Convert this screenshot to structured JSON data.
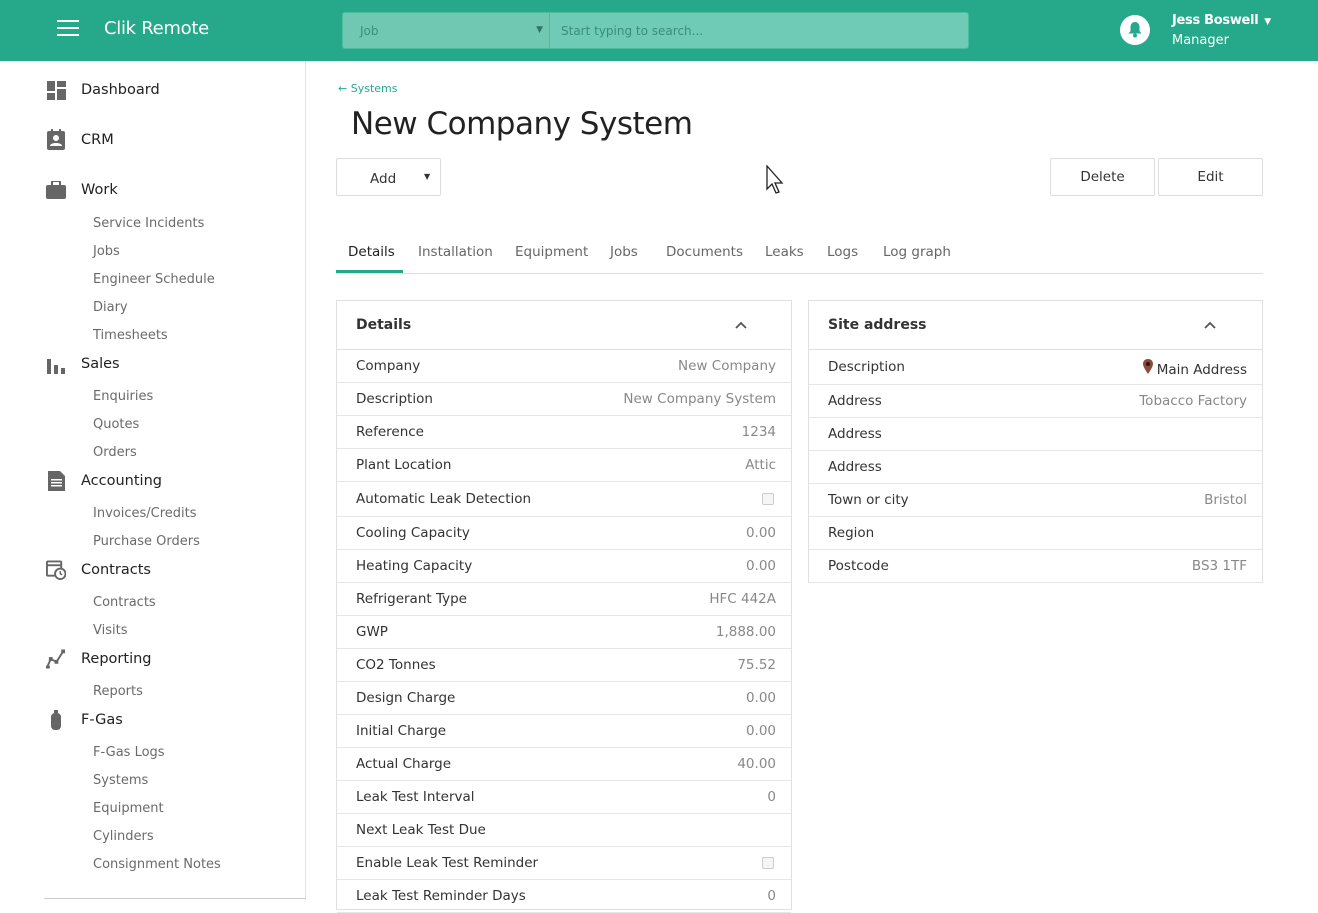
{
  "app": {
    "name": "Clik Remote"
  },
  "search": {
    "category": "Job",
    "placeholder": "Start typing to search..."
  },
  "user": {
    "name": "Jess Boswell",
    "role": "Manager"
  },
  "sidebar": {
    "sections": [
      {
        "label": "Dashboard",
        "icon": "dashboard-icon",
        "items": []
      },
      {
        "label": "CRM",
        "icon": "contact-card-icon",
        "items": []
      },
      {
        "label": "Work",
        "icon": "briefcase-icon",
        "items": [
          "Service Incidents",
          "Jobs",
          "Engineer Schedule",
          "Diary",
          "Timesheets"
        ]
      },
      {
        "label": "Sales",
        "icon": "bar-chart-icon",
        "items": [
          "Enquiries",
          "Quotes",
          "Orders"
        ]
      },
      {
        "label": "Accounting",
        "icon": "document-icon",
        "items": [
          "Invoices/Credits",
          "Purchase Orders"
        ]
      },
      {
        "label": "Contracts",
        "icon": "calendar-clock-icon",
        "items": [
          "Contracts",
          "Visits"
        ]
      },
      {
        "label": "Reporting",
        "icon": "line-chart-icon",
        "items": [
          "Reports"
        ]
      },
      {
        "label": "F-Gas",
        "icon": "gas-cylinder-icon",
        "items": [
          "F-Gas Logs",
          "Systems",
          "Equipment",
          "Cylinders",
          "Consignment Notes"
        ]
      }
    ]
  },
  "breadcrumb": {
    "back_label": "Systems"
  },
  "page": {
    "title": "New Company System"
  },
  "toolbar": {
    "add_label": "Add",
    "delete_label": "Delete",
    "edit_label": "Edit"
  },
  "tabs": [
    "Details",
    "Installation",
    "Equipment",
    "Jobs",
    "Documents",
    "Leaks",
    "Logs",
    "Log graph"
  ],
  "details": {
    "title": "Details",
    "rows": [
      {
        "label": "Company",
        "value": "New Company"
      },
      {
        "label": "Description",
        "value": "New Company System"
      },
      {
        "label": "Reference",
        "value": "1234"
      },
      {
        "label": "Plant Location",
        "value": "Attic"
      },
      {
        "label": "Automatic Leak Detection",
        "value": "",
        "checkbox": true,
        "checked": false
      },
      {
        "label": "Cooling Capacity",
        "value": "0.00"
      },
      {
        "label": "Heating Capacity",
        "value": "0.00"
      },
      {
        "label": "Refrigerant Type",
        "value": "HFC 442A"
      },
      {
        "label": "GWP",
        "value": "1,888.00"
      },
      {
        "label": "CO2 Tonnes",
        "value": "75.52"
      },
      {
        "label": "Design Charge",
        "value": "0.00"
      },
      {
        "label": "Initial Charge",
        "value": "0.00"
      },
      {
        "label": "Actual Charge",
        "value": "40.00"
      },
      {
        "label": "Leak Test Interval",
        "value": "0"
      },
      {
        "label": "Next Leak Test Due",
        "value": ""
      },
      {
        "label": "Enable Leak Test Reminder",
        "value": "",
        "checkbox": true,
        "checked": false
      },
      {
        "label": "Leak Test Reminder Days",
        "value": "0"
      }
    ]
  },
  "site_address": {
    "title": "Site address",
    "rows": [
      {
        "label": "Description",
        "value": "Main Address",
        "icon": "map-pin-icon"
      },
      {
        "label": "Address",
        "value": "Tobacco Factory"
      },
      {
        "label": "Address",
        "value": ""
      },
      {
        "label": "Address",
        "value": ""
      },
      {
        "label": "Town or city",
        "value": "Bristol"
      },
      {
        "label": "Region",
        "value": ""
      },
      {
        "label": "Postcode",
        "value": "BS3 1TF"
      }
    ]
  },
  "colors": {
    "brand": "#26a98b",
    "accent_dark": "#1f8f75"
  }
}
